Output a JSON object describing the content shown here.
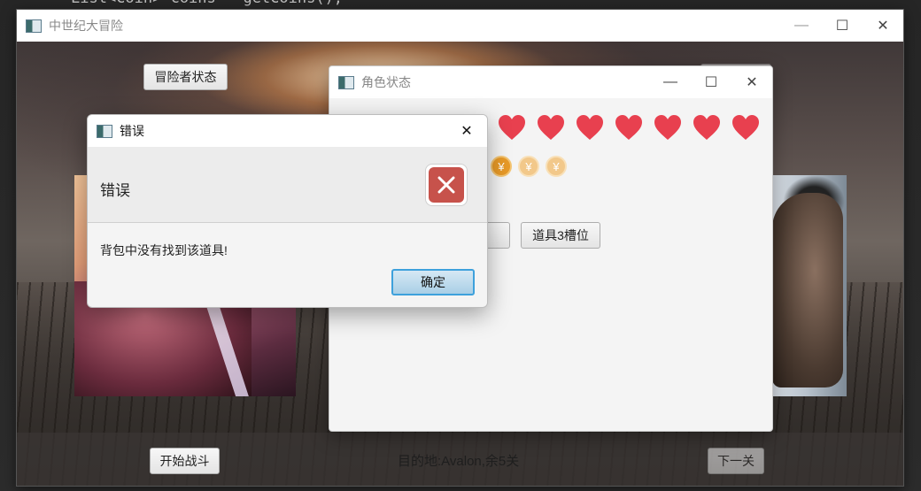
{
  "ide": {
    "code_line": "List<Coin> coins = getCoins();"
  },
  "main_window": {
    "title": "中世纪大冒险",
    "adventurer_status_button": "冒险者状态",
    "start_battle_button": "开始战斗",
    "destination_text": "目的地:Avalon,余5关",
    "next_level_button": "下一关"
  },
  "role_window": {
    "title": "角色状态",
    "hearts_visible": 7,
    "coins": [
      {
        "symbol": "¥",
        "state": "full"
      },
      {
        "symbol": "¥",
        "state": "faded"
      },
      {
        "symbol": "¥",
        "state": "faded"
      }
    ],
    "slot2_button_partial": "位",
    "slot3_button": "道具3槽位"
  },
  "error_dialog": {
    "title": "错误",
    "heading": "错误",
    "message": "背包中没有找到该道具!",
    "ok_button": "确定"
  },
  "colors": {
    "heart": "#e8404f",
    "coin": "#e89a28",
    "error_icon": "#c7524b",
    "focus_border": "#3ea1dc"
  }
}
